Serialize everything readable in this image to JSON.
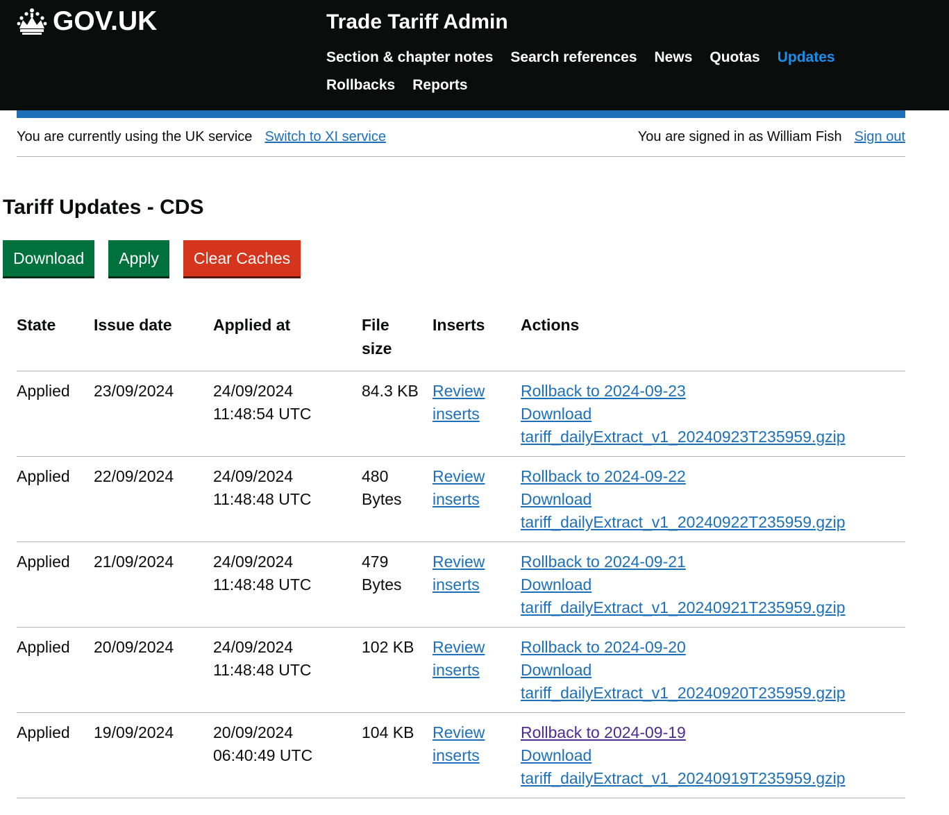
{
  "header": {
    "logo_text": "GOV.UK",
    "service_name": "Trade Tariff Admin",
    "nav": [
      {
        "label": "Section & chapter notes",
        "active": false
      },
      {
        "label": "Search references",
        "active": false
      },
      {
        "label": "News",
        "active": false
      },
      {
        "label": "Quotas",
        "active": false
      },
      {
        "label": "Updates",
        "active": true
      },
      {
        "label": "Rollbacks",
        "active": false
      },
      {
        "label": "Reports",
        "active": false
      }
    ]
  },
  "service_bar": {
    "current_service_text": "You are currently using the UK service",
    "switch_link": "Switch to XI service",
    "signed_in_text": "You are signed in as William Fish",
    "sign_out_link": "Sign out"
  },
  "page": {
    "title": "Tariff Updates - CDS",
    "buttons": {
      "download": "Download",
      "apply": "Apply",
      "clear_caches": "Clear Caches"
    }
  },
  "table": {
    "headers": {
      "state": "State",
      "issue_date": "Issue date",
      "applied_at": "Applied at",
      "file_size": "File size",
      "inserts": "Inserts",
      "actions": "Actions"
    },
    "rows": [
      {
        "state": "Applied",
        "issue_date": "23/09/2024",
        "applied_at": "24/09/2024 11:48:54 UTC",
        "file_size": "84.3 KB",
        "inserts": "Review inserts",
        "rollback": "Rollback to 2024-09-23",
        "download": "Download tariff_dailyExtract_v1_20240923T235959.gzip"
      },
      {
        "state": "Applied",
        "issue_date": "22/09/2024",
        "applied_at": "24/09/2024 11:48:48 UTC",
        "file_size": "480 Bytes",
        "inserts": "Review inserts",
        "rollback": "Rollback to 2024-09-22",
        "download": "Download tariff_dailyExtract_v1_20240922T235959.gzip"
      },
      {
        "state": "Applied",
        "issue_date": "21/09/2024",
        "applied_at": "24/09/2024 11:48:48 UTC",
        "file_size": "479 Bytes",
        "inserts": "Review inserts",
        "rollback": "Rollback to 2024-09-21",
        "download": "Download tariff_dailyExtract_v1_20240921T235959.gzip"
      },
      {
        "state": "Applied",
        "issue_date": "20/09/2024",
        "applied_at": "24/09/2024 11:48:48 UTC",
        "file_size": "102 KB",
        "inserts": "Review inserts",
        "rollback": "Rollback to 2024-09-20",
        "download": "Download tariff_dailyExtract_v1_20240920T235959.gzip"
      },
      {
        "state": "Applied",
        "issue_date": "19/09/2024",
        "applied_at": "20/09/2024 06:40:49 UTC",
        "file_size": "104 KB",
        "inserts": "Review inserts",
        "rollback": "Rollback to 2024-09-19",
        "rollback_visited": true,
        "download": "Download tariff_dailyExtract_v1_20240919T235959.gzip"
      }
    ]
  },
  "colors": {
    "header_bg": "#0b0c0c",
    "link": "#1d70b8",
    "link_visited": "#4c2c92",
    "nav_active": "#1d8feb",
    "button_green": "#00703c",
    "button_red": "#d4351c"
  }
}
